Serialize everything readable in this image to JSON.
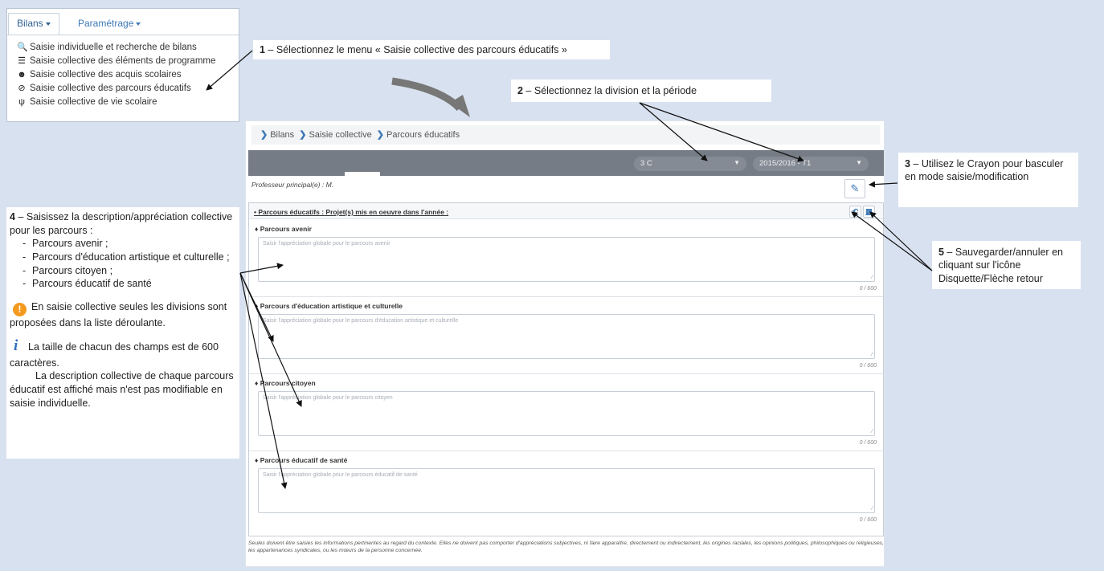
{
  "menu": {
    "tabs": [
      "Bilans",
      "Paramétrage"
    ],
    "items": [
      {
        "icon": "search-icon",
        "glyph": "🔍",
        "label": "Saisie individuelle et recherche de bilans"
      },
      {
        "icon": "list-icon",
        "glyph": "☰",
        "label": "Saisie collective des éléments de programme"
      },
      {
        "icon": "users-icon",
        "glyph": "👥",
        "label": "Saisie collective des acquis scolaires"
      },
      {
        "icon": "compass-icon",
        "glyph": "⊘",
        "label": "Saisie collective des parcours éducatifs"
      },
      {
        "icon": "scale-icon",
        "glyph": "♆",
        "label": "Saisie collective de vie scolaire"
      }
    ]
  },
  "breadcrumb": [
    "Bilans",
    "Saisie collective",
    "Parcours éducatifs"
  ],
  "filters": {
    "division": "3 C",
    "periode": "2015/2016 - T1"
  },
  "prof_label": "Professeur principal(e) : M.",
  "section": {
    "title": "• Parcours éducatifs : Projet(s) mis en oeuvre dans l'année :",
    "blocks": [
      {
        "title": "♦ Parcours avenir",
        "placeholder": "Saisir l'appréciation globale pour le parcours avenir",
        "count": "0 / 600"
      },
      {
        "title": "♦ Parcours d'éducation artistique et culturelle",
        "placeholder": "Saisir l'appréciation globale pour le parcours d'éducation artistique et culturelle",
        "count": "0 / 600"
      },
      {
        "title": "♦ Parcours citoyen",
        "placeholder": "Saisir l'appréciation globale pour le parcours citoyen",
        "count": "0 / 600"
      },
      {
        "title": "♦ Parcours éducatif de santé",
        "placeholder": "Saisir l'appréciation globale pour le parcours éducatif de santé",
        "count": "0 / 600"
      }
    ]
  },
  "footnote": "Seules doivent être saisies les informations pertinentes au regard du contexte. Elles ne doivent pas comporter d'appréciations subjectives, ni faire apparaître, directement ou indirectement, les origines raciales, les opinions politiques, philosophiques ou religieuses, les appartenances syndicales, ou les mœurs de la personne concernée.",
  "notes": {
    "n1": {
      "num": "1",
      "text": " – Sélectionnez le menu « Saisie collective des parcours éducatifs »"
    },
    "n2": {
      "num": "2",
      "text": " – Sélectionnez la division et la période"
    },
    "n3": {
      "num": "3",
      "text": " – Utilisez le Crayon pour basculer en mode saisie/modification"
    },
    "n4": {
      "num": "4",
      "intro": " – Saisissez la description/appréciation collective pour les parcours :",
      "list": [
        "Parcours avenir ;",
        "Parcours d'éducation artistique et culturelle ;",
        "Parcours citoyen ;",
        "Parcours éducatif de santé"
      ],
      "warning": "En saisie collective seules les divisions sont proposées dans la liste déroulante.",
      "info1": "La taille de chacun des champs est de 600 caractères.",
      "info2": "La description collective de chaque parcours éducatif est affiché mais n'est pas modifiable en saisie individuelle."
    },
    "n5": {
      "num": "5",
      "text": " – Sauvegarder/annuler en cliquant sur l'icône Disquette/Flèche retour"
    }
  },
  "colors": {
    "background": "#d8e1ef",
    "accent": "#3c78b5",
    "toolbar": "#757c85",
    "warning": "#f39a1f",
    "info": "#2e6fc0"
  }
}
